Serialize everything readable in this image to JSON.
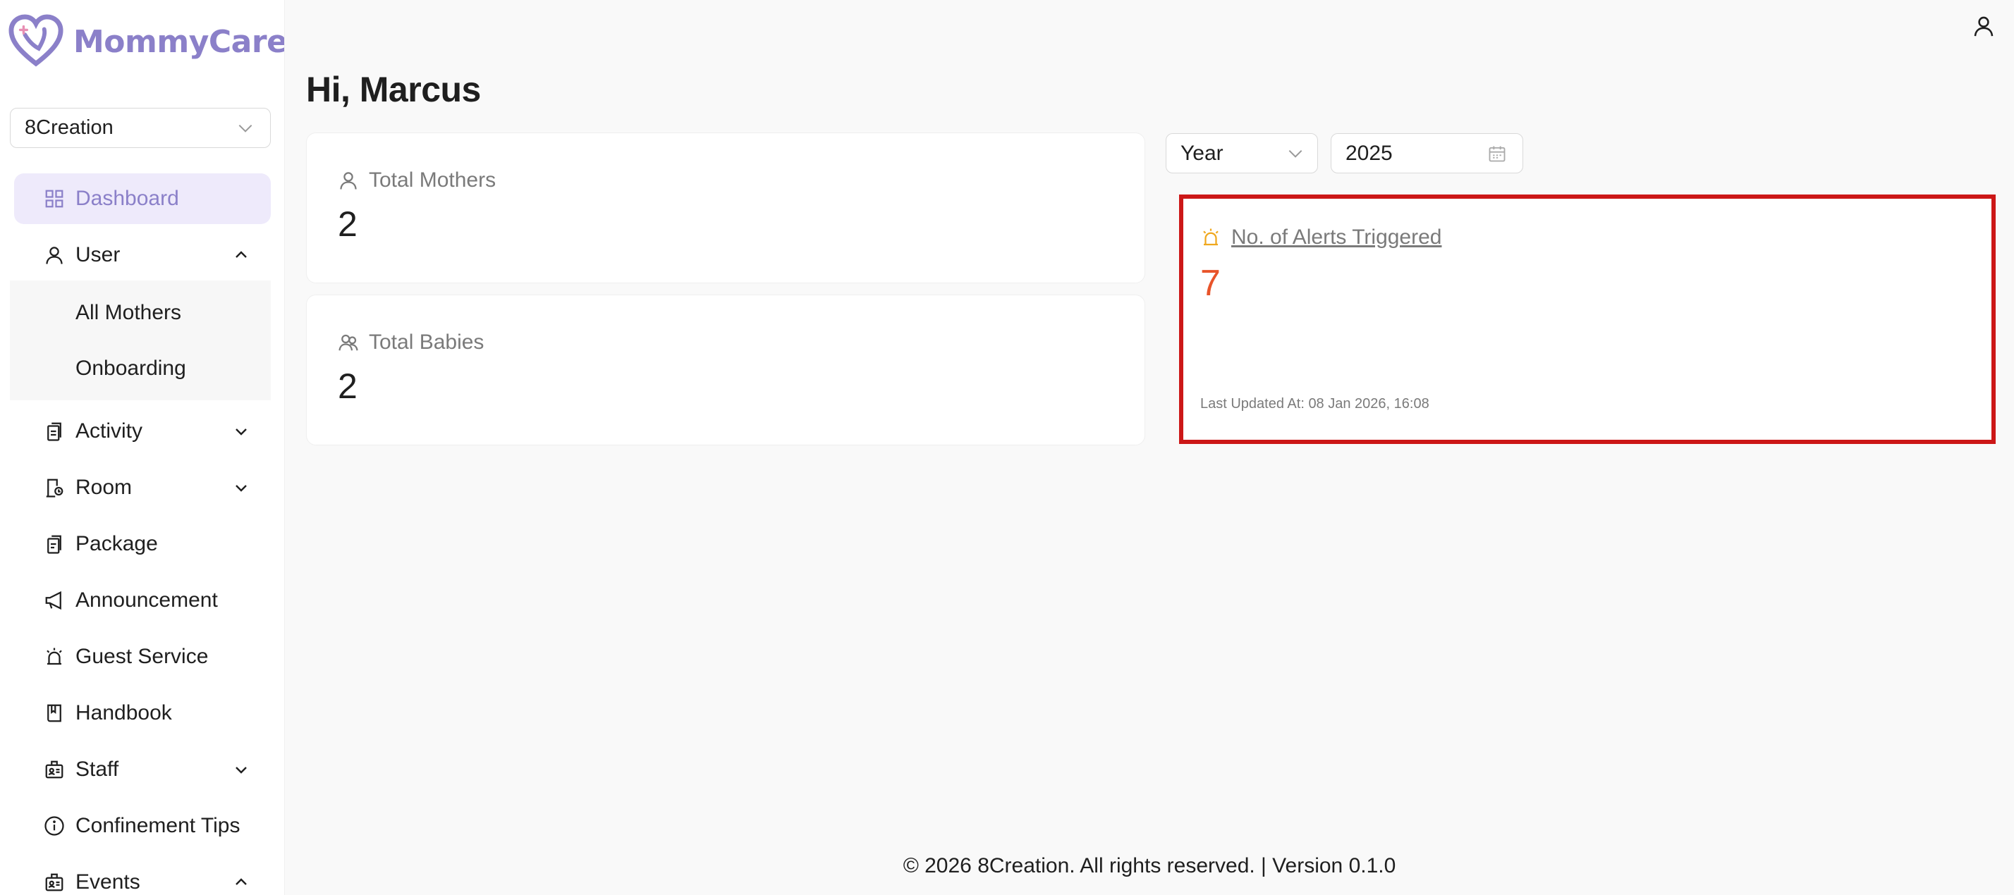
{
  "app": {
    "name": "MommyCare",
    "name_suffix": "+",
    "brand_color": "#8b80c9",
    "accent_pink": "#e88fb4"
  },
  "sidebar": {
    "org_select": {
      "value": "8Creation"
    },
    "items": [
      {
        "label": "Dashboard",
        "icon": "dashboard-grid-icon",
        "active": true
      },
      {
        "label": "User",
        "icon": "user-icon",
        "expanded": true
      },
      {
        "label": "All Mothers"
      },
      {
        "label": "Onboarding"
      },
      {
        "label": "Activity",
        "icon": "clipboard-icon",
        "expanded": false
      },
      {
        "label": "Room",
        "icon": "room-icon",
        "expanded": false
      },
      {
        "label": "Package",
        "icon": "package-icon"
      },
      {
        "label": "Announcement",
        "icon": "megaphone-icon"
      },
      {
        "label": "Guest Service",
        "icon": "alarm-bell-icon"
      },
      {
        "label": "Handbook",
        "icon": "book-icon"
      },
      {
        "label": "Staff",
        "icon": "staff-badge-icon",
        "expanded": false
      },
      {
        "label": "Confinement Tips",
        "icon": "info-icon"
      },
      {
        "label": "Events",
        "icon": "events-icon",
        "expanded": true
      }
    ]
  },
  "header": {
    "greeting": "Hi, Marcus"
  },
  "stats": {
    "total_mothers": {
      "label": "Total Mothers",
      "value": "2"
    },
    "total_babies": {
      "label": "Total Babies",
      "value": "2"
    }
  },
  "filters": {
    "period": {
      "value": "Year"
    },
    "year": {
      "value": "2025"
    }
  },
  "alerts": {
    "label": "No. of Alerts Triggered",
    "value": "7",
    "last_updated": "Last Updated At: 08 Jan 2026, 16:08",
    "value_color": "#e8542a",
    "highlight_color": "#cc1717"
  },
  "footer": {
    "text": "© 2026 8Creation. All rights reserved. | Version 0.1.0"
  }
}
